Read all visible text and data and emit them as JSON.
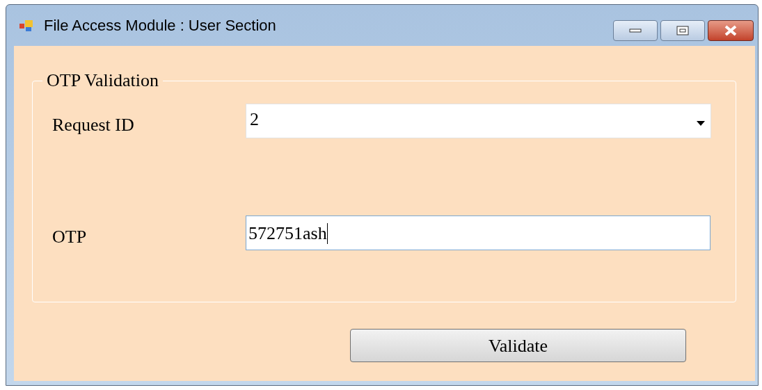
{
  "window": {
    "title": "File Access Module : User Section"
  },
  "group": {
    "title": "OTP Validation",
    "fields": [
      {
        "kind": "dropdown",
        "label": "Request ID",
        "value": "2"
      },
      {
        "kind": "text",
        "label": "OTP",
        "value": "572751ash"
      }
    ]
  },
  "buttons": [
    "Validate"
  ]
}
